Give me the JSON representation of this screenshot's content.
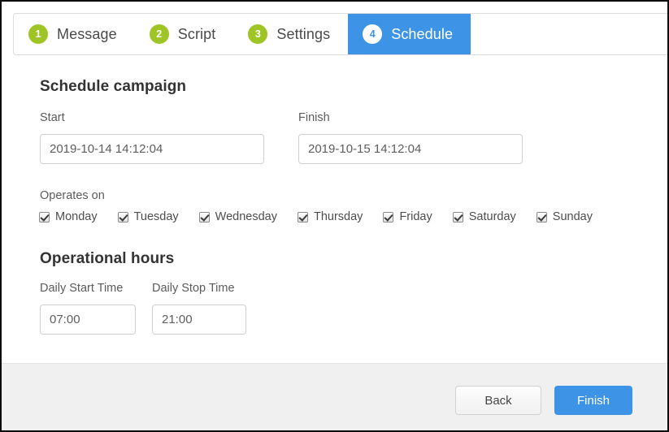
{
  "wizard": {
    "tabs": [
      {
        "number": "1",
        "label": "Message",
        "active": false
      },
      {
        "number": "2",
        "label": "Script",
        "active": false
      },
      {
        "number": "3",
        "label": "Settings",
        "active": false
      },
      {
        "number": "4",
        "label": "Schedule",
        "active": true
      }
    ],
    "badge_color": "#9ec425",
    "active_color": "#3d93e5"
  },
  "schedule": {
    "title": "Schedule campaign",
    "start_label": "Start",
    "start_value": "2019-10-14 14:12:04",
    "start_placeholder": "2019-10-14 14:12:04",
    "finish_label": "Finish",
    "finish_value": "2019-10-15 14:12:04",
    "finish_placeholder": "2019-10-15 14:12:04",
    "operates_label": "Operates on",
    "days": [
      {
        "label": "Monday",
        "checked": true
      },
      {
        "label": "Tuesday",
        "checked": true
      },
      {
        "label": "Wednesday",
        "checked": true
      },
      {
        "label": "Thursday",
        "checked": true
      },
      {
        "label": "Friday",
        "checked": true
      },
      {
        "label": "Saturday",
        "checked": true
      },
      {
        "label": "Sunday",
        "checked": true
      }
    ]
  },
  "hours": {
    "title": "Operational hours",
    "start_label": "Daily Start Time",
    "start_value": "07:00",
    "start_placeholder": "07:00",
    "stop_label": "Daily Stop Time",
    "stop_value": "21:00",
    "stop_placeholder": "21:00"
  },
  "footer": {
    "back_label": "Back",
    "finish_label": "Finish"
  }
}
